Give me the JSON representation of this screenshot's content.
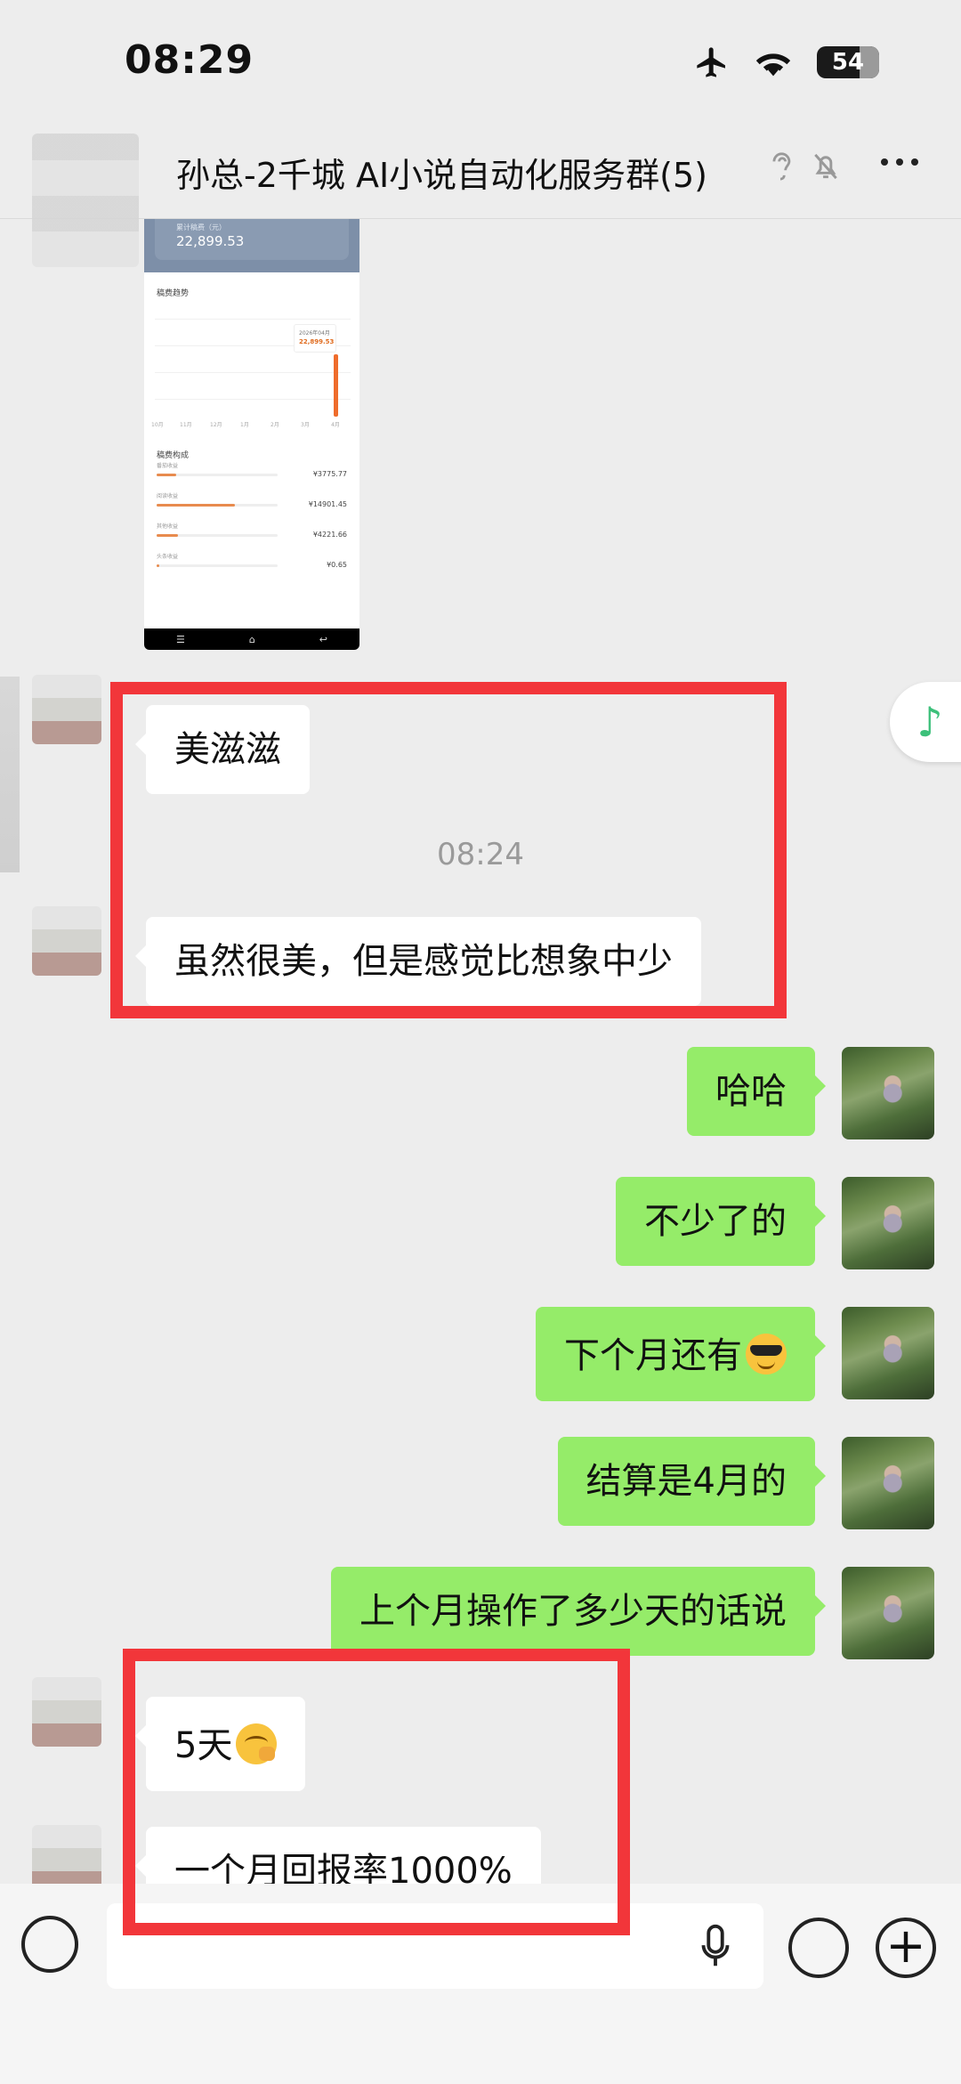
{
  "status_bar": {
    "time": "08:29",
    "battery": "54"
  },
  "header": {
    "title": "孙总-2千城 AI小说自动化服务群(5)"
  },
  "embedded_screenshot": {
    "total_label": "累计稿费（元）",
    "total_value": "22,899.53",
    "trend_title": "稿费趋势",
    "tooltip_date": "2026年04月",
    "tooltip_value": "22,899.53",
    "x_labels": [
      "10月",
      "11月",
      "12月",
      "1月",
      "2月",
      "3月",
      "4月"
    ],
    "breakdown_title": "稿费构成",
    "items": [
      {
        "label": "番茄收益",
        "amount": "¥3775.77",
        "fraction": 0.16
      },
      {
        "label": "阅读收益",
        "amount": "¥14901.45",
        "fraction": 0.65
      },
      {
        "label": "其他收益",
        "amount": "¥4221.66",
        "fraction": 0.18
      },
      {
        "label": "头条收益",
        "amount": "¥0.65",
        "fraction": 0.02
      }
    ]
  },
  "messages": {
    "m1": "美滋滋",
    "timestamp": "08:24",
    "m2": "虽然很美，但是感觉比想象中少",
    "m3": "哈哈",
    "m4": "不少了的",
    "m5": "下个月还有",
    "m6": "结算是4月的",
    "m7": "上个月操作了多少天的话说",
    "m8": "5天",
    "m9": "一个月回报率1000%"
  },
  "icons": {
    "airplane": "airplane-icon",
    "wifi": "wifi-icon",
    "back": "back-icon",
    "ear": "ear-icon",
    "mute": "mute-bell-icon",
    "more": "more-icon",
    "music": "music-note-icon",
    "voice": "voice-icon",
    "mic": "mic-icon",
    "emoji": "emoji-icon",
    "plus": "plus-icon"
  },
  "colors": {
    "outgoing_bubble": "#95ec69",
    "highlight": "#f2363a",
    "accent_orange": "#ef6c2b"
  }
}
